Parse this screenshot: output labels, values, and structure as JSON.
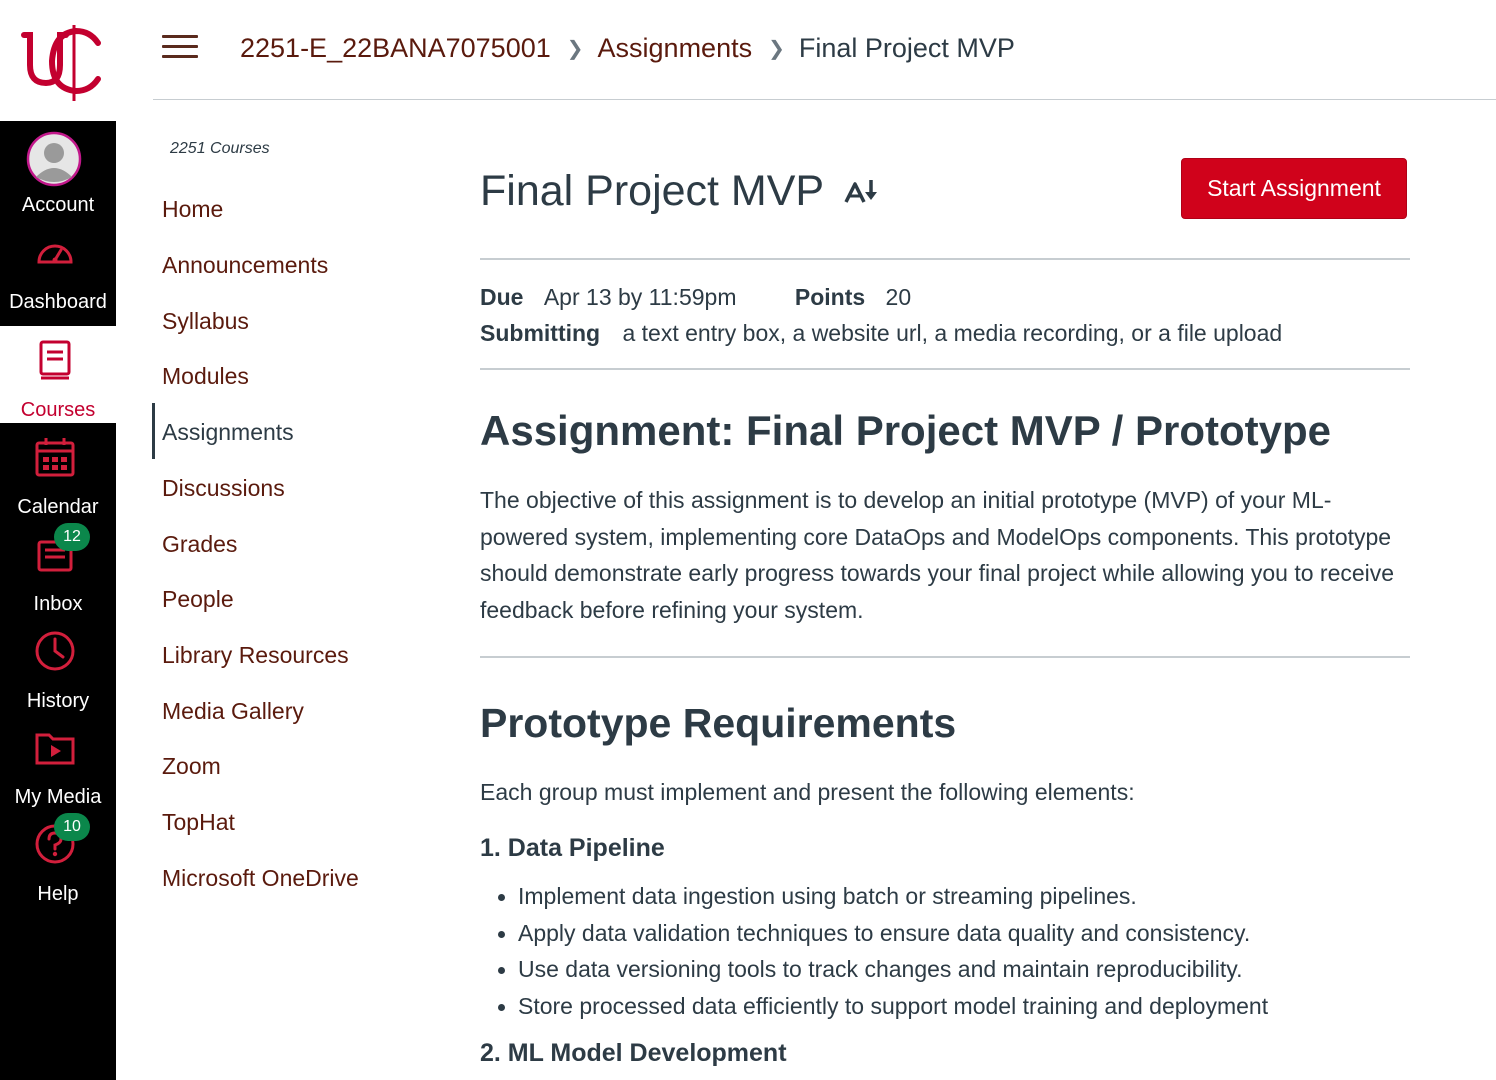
{
  "global_nav": {
    "logo": "uc-logo",
    "items": [
      {
        "label": "Account",
        "icon": "avatar-icon",
        "active": false
      },
      {
        "label": "Dashboard",
        "icon": "dashboard-icon",
        "active": false
      },
      {
        "label": "Courses",
        "icon": "courses-icon",
        "active": true
      },
      {
        "label": "Calendar",
        "icon": "calendar-icon",
        "active": false
      },
      {
        "label": "Inbox",
        "icon": "inbox-icon",
        "badge": "12",
        "active": false
      },
      {
        "label": "History",
        "icon": "clock-icon",
        "active": false
      },
      {
        "label": "My Media",
        "icon": "media-icon",
        "active": false
      },
      {
        "label": "Help",
        "icon": "help-icon",
        "badge": "10",
        "active": false
      }
    ]
  },
  "header": {
    "breadcrumbs": [
      "2251-E_22BANA7075001",
      "Assignments",
      "Final Project MVP"
    ]
  },
  "course_nav": {
    "term": "2251 Courses",
    "items": [
      "Home",
      "Announcements",
      "Syllabus",
      "Modules",
      "Assignments",
      "Discussions",
      "Grades",
      "People",
      "Library Resources",
      "Media Gallery",
      "Zoom",
      "TopHat",
      "Microsoft OneDrive"
    ],
    "active": "Assignments"
  },
  "assignment": {
    "title": "Final Project MVP",
    "start_button": "Start Assignment",
    "due_label": "Due",
    "due_value": "Apr 13 by 11:59pm",
    "points_label": "Points",
    "points_value": "20",
    "submitting_label": "Submitting",
    "submitting_value": "a text entry box, a website url, a media recording, or a file upload"
  },
  "content": {
    "heading": "Assignment: Final Project MVP / Prototype",
    "paragraph": "The objective of this assignment is to develop an initial prototype (MVP) of your ML-powered system, implementing core DataOps and ModelOps components. This prototype should demonstrate early progress towards your final project while allowing you to receive feedback before refining your system.",
    "requirements_heading": "Prototype Requirements",
    "requirements_intro": "Each group must implement and present the following elements:",
    "section1_heading": "1. Data Pipeline",
    "section1_bullets": [
      "Implement data ingestion using batch or streaming pipelines.",
      "Apply data validation techniques to ensure data quality and consistency.",
      "Use data versioning tools to track changes and maintain reproducibility.",
      "Store processed data efficiently to support model training and deployment"
    ],
    "section2_heading": "2. ML Model Development"
  },
  "colors": {
    "brand_red": "#c3002f",
    "button_red": "#d0021b",
    "link_brown": "#5a1a0d",
    "badge_green": "#0b874b",
    "nav_black": "#000000"
  }
}
